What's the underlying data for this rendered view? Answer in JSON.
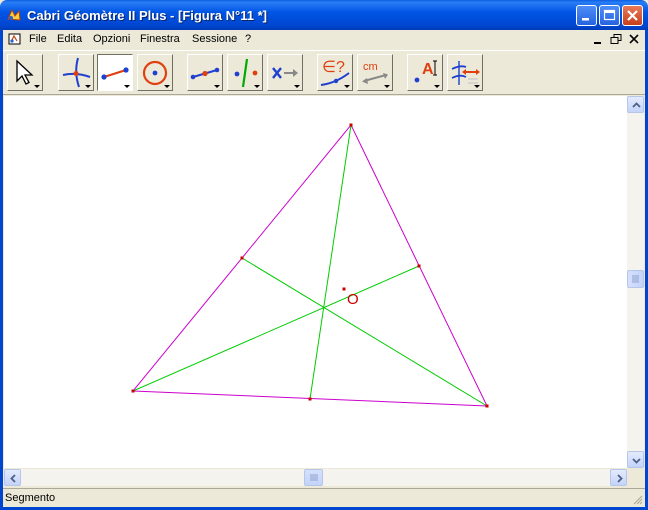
{
  "window": {
    "title": "Cabri Géomètre II Plus - [Figura N°11 *]"
  },
  "menu": {
    "items": [
      {
        "label": "File",
        "name": "menu-file"
      },
      {
        "label": "Edita",
        "name": "menu-edita"
      },
      {
        "label": "Opzioni",
        "name": "menu-opzioni"
      },
      {
        "label": "Finestra",
        "name": "menu-finestra"
      },
      {
        "label": "Sessione",
        "name": "menu-sessione"
      },
      {
        "label": "?",
        "name": "menu-help"
      }
    ]
  },
  "toolbar": {
    "tools": [
      {
        "name": "pointer-tool",
        "icon": "cursor-arrow-icon"
      },
      {
        "name": "points-tool",
        "icon": "point-on-curves-icon"
      },
      {
        "name": "lines-tool",
        "icon": "segment-icon",
        "pressed": true
      },
      {
        "name": "curves-tool",
        "icon": "circle-icon"
      },
      {
        "name": "construct-tool",
        "icon": "midpoint-icon"
      },
      {
        "name": "transform-tool",
        "icon": "symmetry-icon"
      },
      {
        "name": "macro-tool",
        "icon": "macro-icon"
      },
      {
        "name": "check-property-tool",
        "icon": "membership-check-icon",
        "label": "∈?"
      },
      {
        "name": "measure-tool",
        "icon": "distance-measure-icon",
        "label": "cm"
      },
      {
        "name": "display-tool",
        "icon": "label-icon",
        "label": "A"
      },
      {
        "name": "drawing-tool",
        "icon": "mark-angle-icon"
      }
    ]
  },
  "figure": {
    "point_label": "O",
    "colors": {
      "triangle": "#cc00cc",
      "medians": "#00cc00",
      "points": "#cc0000",
      "label": "#cc0000"
    }
  },
  "status": {
    "text": "Segmento"
  }
}
